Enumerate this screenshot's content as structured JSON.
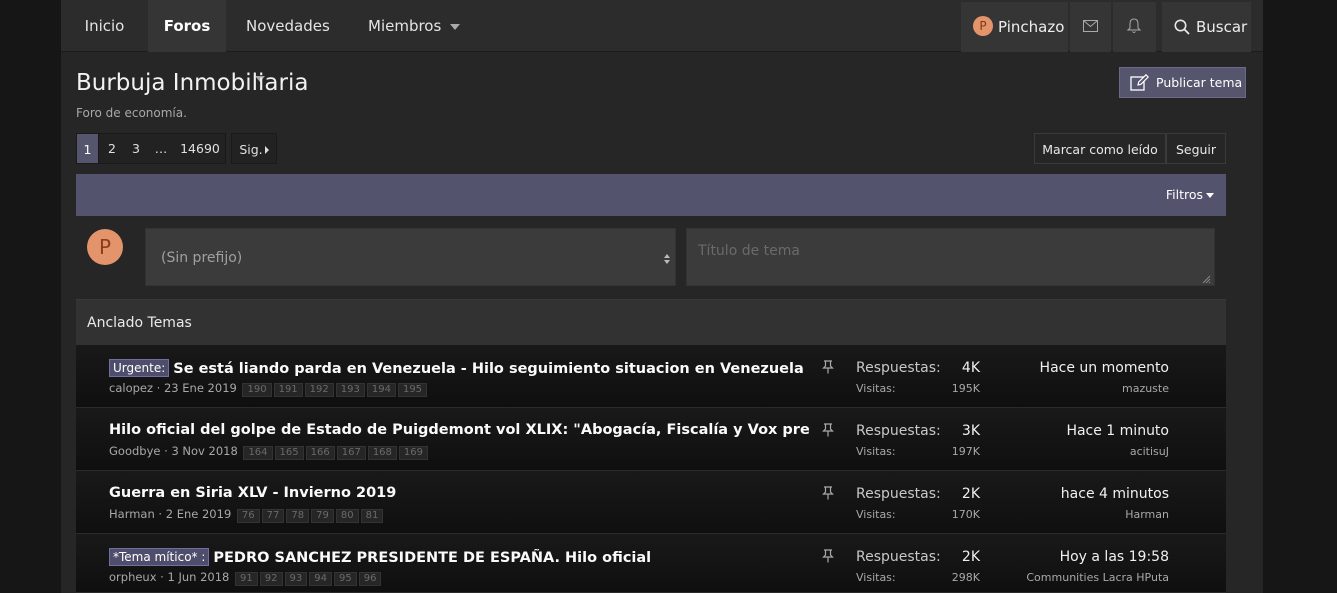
{
  "nav": {
    "inicio": "Inicio",
    "foros": "Foros",
    "novedades": "Novedades",
    "miembros": "Miembros",
    "user_initial": "P",
    "username": "Pinchazo",
    "search": "Buscar"
  },
  "header": {
    "title": "Burbuja Inmobiliaria",
    "subtitle": "Foro de economía.",
    "publish": "Publicar tema"
  },
  "pagination": {
    "pages": [
      "1",
      "2",
      "3",
      "…",
      "14690"
    ],
    "current": "1",
    "next": "Sig."
  },
  "actions": {
    "mark_read": "Marcar como leído",
    "follow": "Seguir"
  },
  "filters": {
    "label": "Filtros"
  },
  "quick_thread": {
    "avatar_initial": "P",
    "prefix": "(Sin prefijo)",
    "title_placeholder": "Título de tema"
  },
  "sticky_heading": "Anclado Temas",
  "labels": {
    "replies": "Respuestas:",
    "views": "Visitas:"
  },
  "threads": [
    {
      "prefix": "Urgente:",
      "title": "Se está liando parda en Venezuela - Hilo seguimiento situacion en Venezuela (IV)",
      "author": "calopez",
      "date": "23 Ene 2019",
      "pages": [
        "190",
        "191",
        "192",
        "193",
        "194",
        "195"
      ],
      "replies": "4K",
      "views": "195K",
      "last_time": "Hace un momento",
      "last_user": "mazuste"
    },
    {
      "prefix": "",
      "title": "Hilo oficial del golpe de Estado de Puigdemont vol XLIX: \"Abogacía, Fiscalía y Vox presentan sus esc",
      "author": "Goodbye",
      "date": "3 Nov 2018",
      "pages": [
        "164",
        "165",
        "166",
        "167",
        "168",
        "169"
      ],
      "replies": "3K",
      "views": "197K",
      "last_time": "Hace 1 minuto",
      "last_user": "acitisuJ"
    },
    {
      "prefix": "",
      "title": "Guerra en Siria XLV - Invierno 2019",
      "author": "Harman",
      "date": "2 Ene 2019",
      "pages": [
        "76",
        "77",
        "78",
        "79",
        "80",
        "81"
      ],
      "replies": "2K",
      "views": "170K",
      "last_time": "hace 4 minutos",
      "last_user": "Harman"
    },
    {
      "prefix": "*Tema mítico* :",
      "title": "PEDRO SANCHEZ PRESIDENTE DE ESPAÑA. Hilo oficial",
      "author": "orpheux",
      "date": "1 Jun 2018",
      "pages": [
        "91",
        "92",
        "93",
        "94",
        "95",
        "96"
      ],
      "replies": "2K",
      "views": "298K",
      "last_time": "Hoy a las 19:58",
      "last_user": "Communities Lacra HPuta"
    }
  ]
}
